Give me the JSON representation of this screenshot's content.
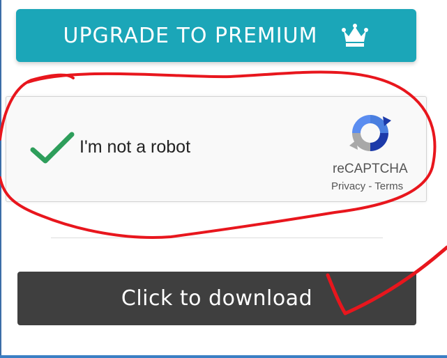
{
  "premium": {
    "label": "UPGRADE TO PREMIUM",
    "icon": "crown-icon"
  },
  "captcha": {
    "label": "I'm not a robot",
    "checked": true,
    "brand": "reCAPTCHA",
    "privacy_link": "Privacy",
    "separator": "-",
    "terms_link": "Terms",
    "icons": [
      "check-icon",
      "recaptcha-logo-icon"
    ]
  },
  "download": {
    "label": "Click to download"
  },
  "colors": {
    "premium_bg": "#1ba6b8",
    "download_bg": "#3f3f3f",
    "checkmark": "#2e9e5b",
    "annotation": "#e8161d"
  }
}
